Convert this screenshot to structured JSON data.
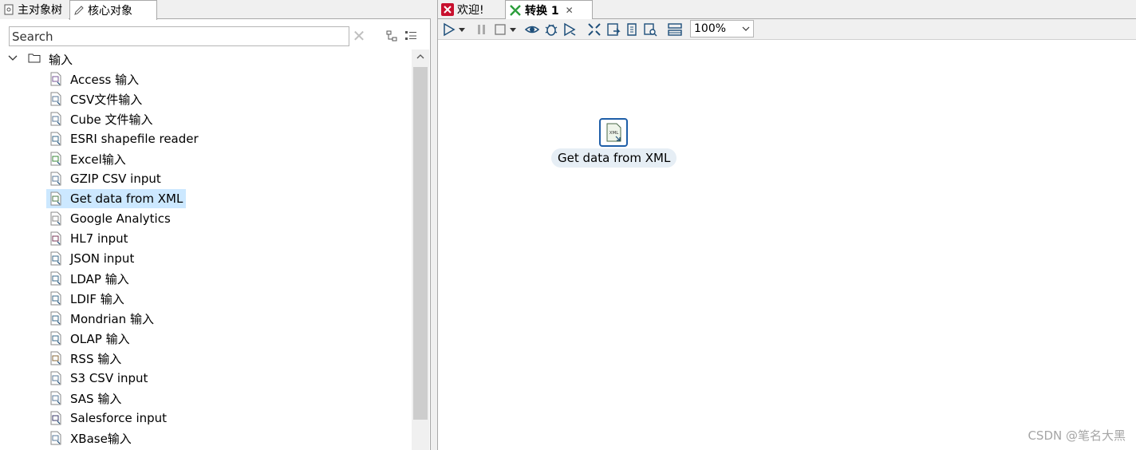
{
  "left_panel": {
    "tabs": [
      {
        "label": "主对象树",
        "icon": "object-tree-icon"
      },
      {
        "label": "核心对象",
        "icon": "pencil-icon"
      }
    ],
    "search": {
      "placeholder": "Search",
      "value": ""
    },
    "tree": {
      "folder": {
        "label": "输入",
        "icon": "folder-icon",
        "expanded": true
      },
      "items": [
        {
          "label": "Access 输入",
          "icon": "access-input-icon"
        },
        {
          "label": "CSV文件输入",
          "icon": "csv-input-icon"
        },
        {
          "label": "Cube 文件输入",
          "icon": "cube-input-icon"
        },
        {
          "label": "ESRI shapefile reader",
          "icon": "esri-shapefile-icon"
        },
        {
          "label": "Excel输入",
          "icon": "excel-input-icon"
        },
        {
          "label": "GZIP CSV input",
          "icon": "gzip-csv-icon"
        },
        {
          "label": "Get data from XML",
          "icon": "xml-input-icon",
          "selected": true
        },
        {
          "label": "Google Analytics",
          "icon": "google-analytics-icon"
        },
        {
          "label": "HL7 input",
          "icon": "hl7-input-icon"
        },
        {
          "label": "JSON input",
          "icon": "json-input-icon"
        },
        {
          "label": "LDAP 输入",
          "icon": "ldap-input-icon"
        },
        {
          "label": "LDIF 输入",
          "icon": "ldif-input-icon"
        },
        {
          "label": "Mondrian 输入",
          "icon": "mondrian-input-icon"
        },
        {
          "label": "OLAP 输入",
          "icon": "olap-input-icon"
        },
        {
          "label": "RSS 输入",
          "icon": "rss-input-icon"
        },
        {
          "label": "S3 CSV input",
          "icon": "s3-csv-icon"
        },
        {
          "label": "SAS 输入",
          "icon": "sas-input-icon"
        },
        {
          "label": "Salesforce input",
          "icon": "salesforce-input-icon"
        },
        {
          "label": "XBase输入",
          "icon": "xbase-input-icon"
        }
      ]
    }
  },
  "right_panel": {
    "tabs": [
      {
        "label": "欢迎!",
        "icon": "welcome-icon"
      },
      {
        "label": "转换 1",
        "icon": "transformation-icon",
        "active": true
      }
    ],
    "toolbar": {
      "zoom": "100%"
    },
    "canvas": {
      "step": {
        "label": "Get data from XML",
        "icon": "xml-input-icon",
        "icon_text": "XML"
      }
    }
  },
  "watermark": "CSDN @笔名大黑",
  "colors": {
    "selection": "#cce8ff",
    "step_border": "#1e5ea8",
    "step_label_bg": "#e6eef5"
  }
}
